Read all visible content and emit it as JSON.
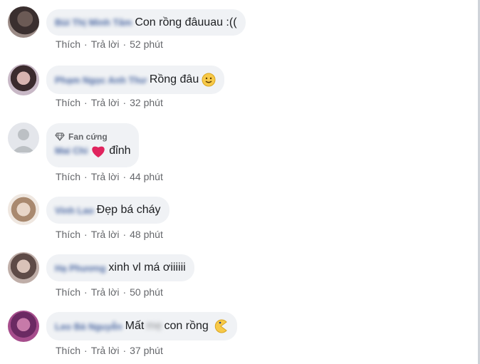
{
  "comments": [
    {
      "author": "Bùi Thị Minh Tâm",
      "text": "Con rồng đâuuau :((",
      "like": "Thích",
      "reply": "Trả lời",
      "time": "52 phút"
    },
    {
      "author": "Phạm Ngọc Anh Thư",
      "text": "Rồng đâu",
      "emoji": "smile-emoji",
      "like": "Thích",
      "reply": "Trả lời",
      "time": "32 phút"
    },
    {
      "badge": "Fan cứng",
      "author": "Mai Chi",
      "emoji": "red-heart-emoji",
      "text": "đỉnh",
      "like": "Thích",
      "reply": "Trả lời",
      "time": "44 phút"
    },
    {
      "author": "Vinh Lao",
      "text": "Đẹp bá cháy",
      "like": "Thích",
      "reply": "Trả lời",
      "time": "48 phút"
    },
    {
      "author": "Hạ Phương",
      "text": "xinh vl má ơiiiiii",
      "like": "Thích",
      "reply": "Trả lời",
      "time": "50 phút"
    },
    {
      "author": "Leo Bá Nguyễn",
      "text_before": "Mất",
      "text_blurred": "mẹ",
      "text_after": "con rồng",
      "emoji": "pacman-emoji",
      "like": "Thích",
      "reply": "Trả lời",
      "time": "37 phút"
    }
  ],
  "colors": {
    "bubble": "#f0f2f5",
    "author": "#385898",
    "meta": "#65676b",
    "heart": "#e0245e",
    "emoji_yellow": "#f7c948"
  }
}
